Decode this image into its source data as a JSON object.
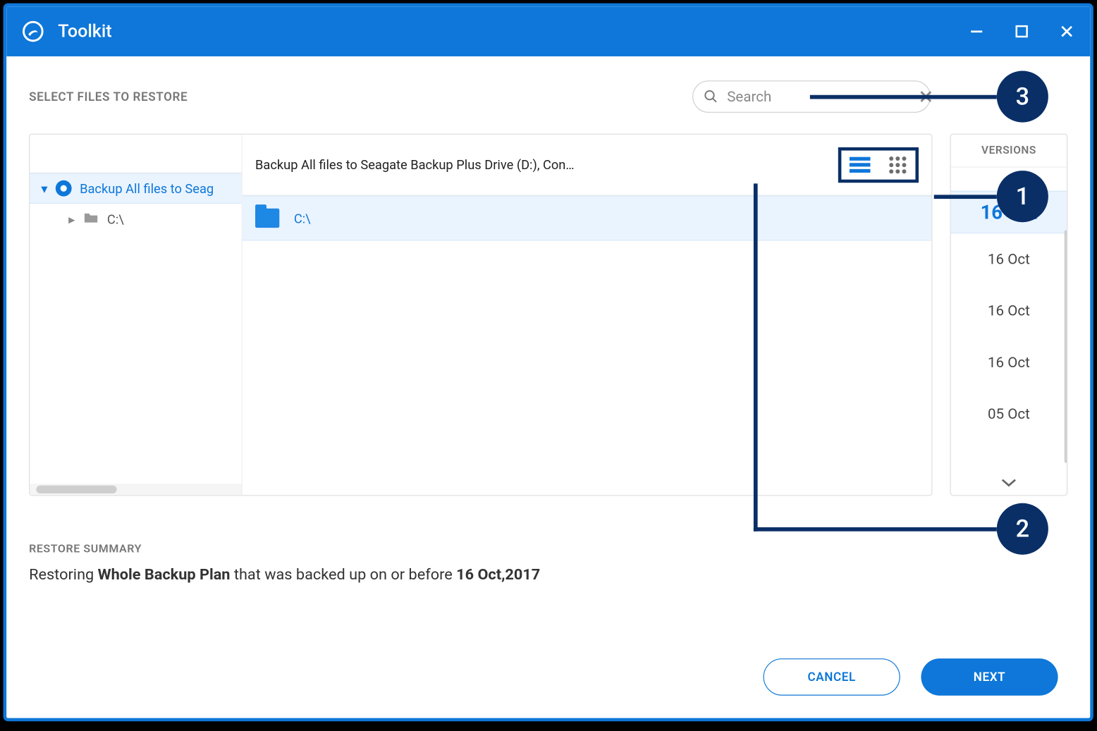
{
  "app": {
    "title": "Toolkit"
  },
  "section_heading": "SELECT FILES TO RESTORE",
  "search": {
    "placeholder": "Search"
  },
  "tree": {
    "root_label": "Backup All files to Seag",
    "child_label": "C:\\"
  },
  "breadcrumb": "Backup All files to Seagate Backup Plus Drive (D:), Con…",
  "file_row": {
    "name": "C:\\"
  },
  "versions": {
    "header": "VERSIONS",
    "items": [
      "16 Oct",
      "16 Oct",
      "16 Oct",
      "16 Oct",
      "05 Oct"
    ],
    "selected_index": 0
  },
  "summary": {
    "header": "RESTORE SUMMARY",
    "prefix": "Restoring ",
    "bold1": "Whole Backup Plan",
    "mid": " that was backed up on or before ",
    "bold2": "16 Oct,2017"
  },
  "buttons": {
    "cancel": "CANCEL",
    "next": "NEXT"
  },
  "callouts": {
    "c1": "1",
    "c2": "2",
    "c3": "3"
  }
}
